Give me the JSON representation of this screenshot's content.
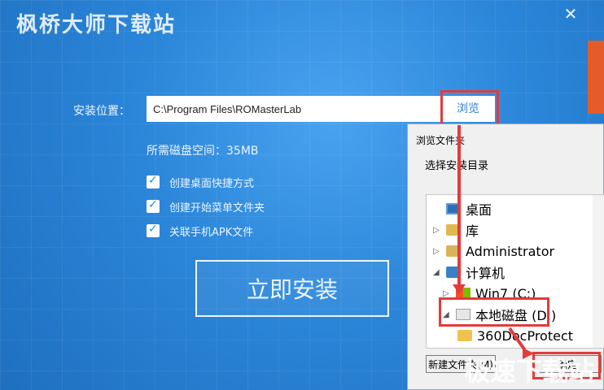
{
  "window": {
    "title": "枫桥大师下载站",
    "close": "✕"
  },
  "install": {
    "location_label": "安装位置：",
    "path_value": "C:\\Program Files\\ROMasterLab",
    "browse_label": "浏览",
    "disk_space": "所需磁盘空间：35MB",
    "options": [
      {
        "label": "创建桌面快捷方式",
        "checked": true
      },
      {
        "label": "创建开始菜单文件夹",
        "checked": true
      },
      {
        "label": "关联手机APK文件",
        "checked": true
      }
    ],
    "install_button": "立即安装"
  },
  "dialog": {
    "title": "浏览文件夹",
    "prompt": "选择安装目录",
    "tree": [
      {
        "label": "桌面",
        "icon": "desktop-icon"
      },
      {
        "label": "库",
        "icon": "library-icon"
      },
      {
        "label": "Administrator",
        "icon": "user-folder-icon"
      },
      {
        "label": "计算机",
        "icon": "computer-icon"
      },
      {
        "label": "Win7 (C:)",
        "icon": "windows-drive-icon"
      },
      {
        "label": "本地磁盘 (D:)",
        "icon": "drive-icon"
      },
      {
        "label": "360DocProtect",
        "icon": "folder-icon"
      }
    ],
    "new_folder_button": "新建文件夹(M)",
    "ok_button": "确定"
  },
  "watermark": "极速下载站",
  "colors": {
    "accent_red": "#e23b3b",
    "installer_blue": "#2b86d9"
  }
}
